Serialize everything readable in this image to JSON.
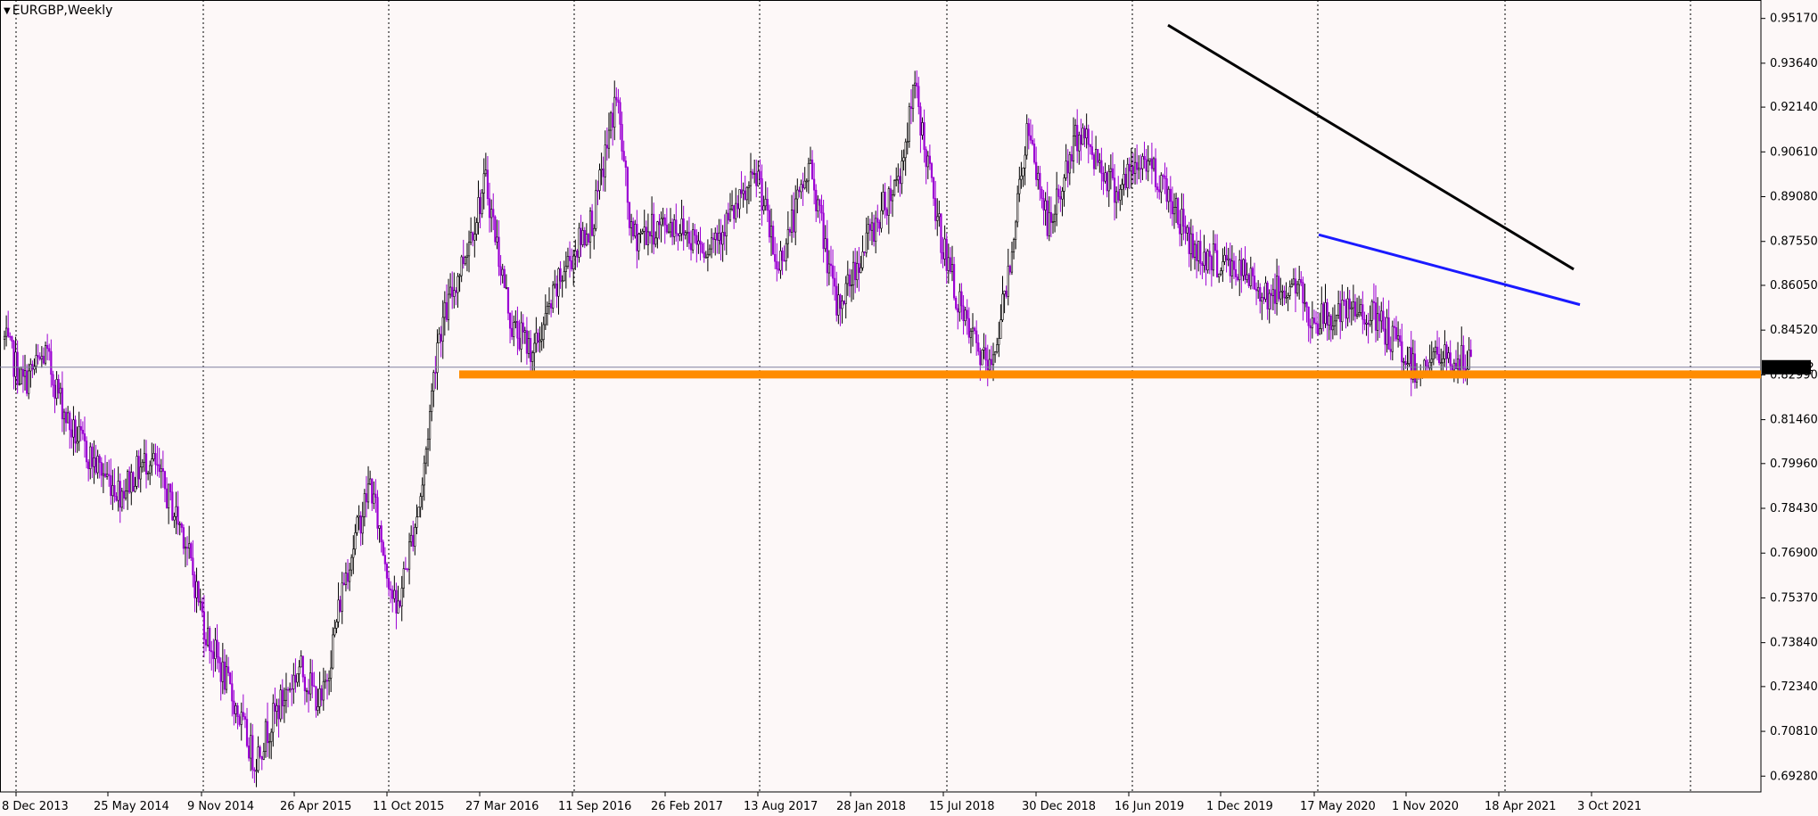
{
  "header": {
    "menu_icon": "triangle-down-icon",
    "symbol_label": "EURGBP,Weekly"
  },
  "colors": {
    "background": "#fdf8f8",
    "bull_candle": "#000000",
    "bear_candle": "#9b00d3",
    "support_zone": "#ff8c00",
    "upper_trendline": "#000000",
    "lower_trendline": "#1a1aff",
    "current_price_line": "#8080a0",
    "price_tag_bg": "#000000",
    "price_tag_text": "#ffffff",
    "grid": "#000000"
  },
  "chart_data": {
    "type": "candlestick",
    "title": "EURGBP,Weekly",
    "x_labels": [
      "8 Dec 2013",
      "25 May 2014",
      "9 Nov 2014",
      "26 Apr 2015",
      "11 Oct 2015",
      "27 Mar 2016",
      "11 Sep 2016",
      "26 Feb 2017",
      "13 Aug 2017",
      "28 Jan 2018",
      "15 Jul 2018",
      "30 Dec 2018",
      "16 Jun 2019",
      "1 Dec 2019",
      "17 May 2020",
      "1 Nov 2020",
      "18 Apr 2021",
      "3 Oct 2021"
    ],
    "y_ticks": [
      "0.95170",
      "0.93640",
      "0.92140",
      "0.90610",
      "0.89080",
      "0.87550",
      "0.86050",
      "0.84520",
      "0.82990",
      "0.81460",
      "0.79960",
      "0.78430",
      "0.76900",
      "0.75370",
      "0.73840",
      "0.72340",
      "0.70810",
      "0.69280"
    ],
    "ylim": [
      0.6874,
      0.958
    ],
    "current_price": "0.83252",
    "grid": "vertical dotted at label dates",
    "close_path_weekly": [
      [
        0,
        0.842
      ],
      [
        10,
        0.827
      ],
      [
        22,
        0.837
      ],
      [
        35,
        0.812
      ],
      [
        48,
        0.8
      ],
      [
        62,
        0.79
      ],
      [
        78,
        0.802
      ],
      [
        96,
        0.776
      ],
      [
        108,
        0.742
      ],
      [
        122,
        0.72
      ],
      [
        134,
        0.698
      ],
      [
        142,
        0.71
      ],
      [
        158,
        0.73
      ],
      [
        170,
        0.717
      ],
      [
        182,
        0.76
      ],
      [
        196,
        0.793
      ],
      [
        210,
        0.748
      ],
      [
        224,
        0.792
      ],
      [
        232,
        0.842
      ],
      [
        246,
        0.87
      ],
      [
        258,
        0.896
      ],
      [
        272,
        0.846
      ],
      [
        284,
        0.838
      ],
      [
        300,
        0.866
      ],
      [
        316,
        0.884
      ],
      [
        328,
        0.926
      ],
      [
        336,
        0.877
      ],
      [
        358,
        0.882
      ],
      [
        376,
        0.874
      ],
      [
        392,
        0.886
      ],
      [
        404,
        0.898
      ],
      [
        414,
        0.866
      ],
      [
        432,
        0.902
      ],
      [
        446,
        0.852
      ],
      [
        464,
        0.878
      ],
      [
        480,
        0.899
      ],
      [
        488,
        0.928
      ],
      [
        500,
        0.882
      ],
      [
        514,
        0.848
      ],
      [
        528,
        0.831
      ],
      [
        536,
        0.856
      ],
      [
        548,
        0.913
      ],
      [
        560,
        0.88
      ],
      [
        576,
        0.914
      ],
      [
        596,
        0.893
      ],
      [
        612,
        0.904
      ],
      [
        624,
        0.892
      ],
      [
        638,
        0.872
      ],
      [
        660,
        0.866
      ],
      [
        678,
        0.857
      ],
      [
        692,
        0.861
      ],
      [
        700,
        0.849
      ],
      [
        716,
        0.85
      ],
      [
        730,
        0.852
      ],
      [
        748,
        0.839
      ],
      [
        756,
        0.832
      ],
      [
        768,
        0.836
      ],
      [
        786,
        0.834
      ]
    ],
    "annotations": [
      {
        "type": "support_zone",
        "price": 0.8299,
        "color": "#ff8c00",
        "start_label": "27 Mar 2016"
      },
      {
        "type": "trendline",
        "color": "#000000",
        "from": [
          "1 Dec 2019",
          0.9494
        ],
        "to": [
          "after 3 Oct 2021",
          0.866
        ]
      },
      {
        "type": "trendline",
        "color": "#1a1aff",
        "from": [
          "1 Nov 2020",
          0.8778
        ],
        "to": [
          "after 3 Oct 2021",
          0.8539
        ]
      }
    ]
  }
}
